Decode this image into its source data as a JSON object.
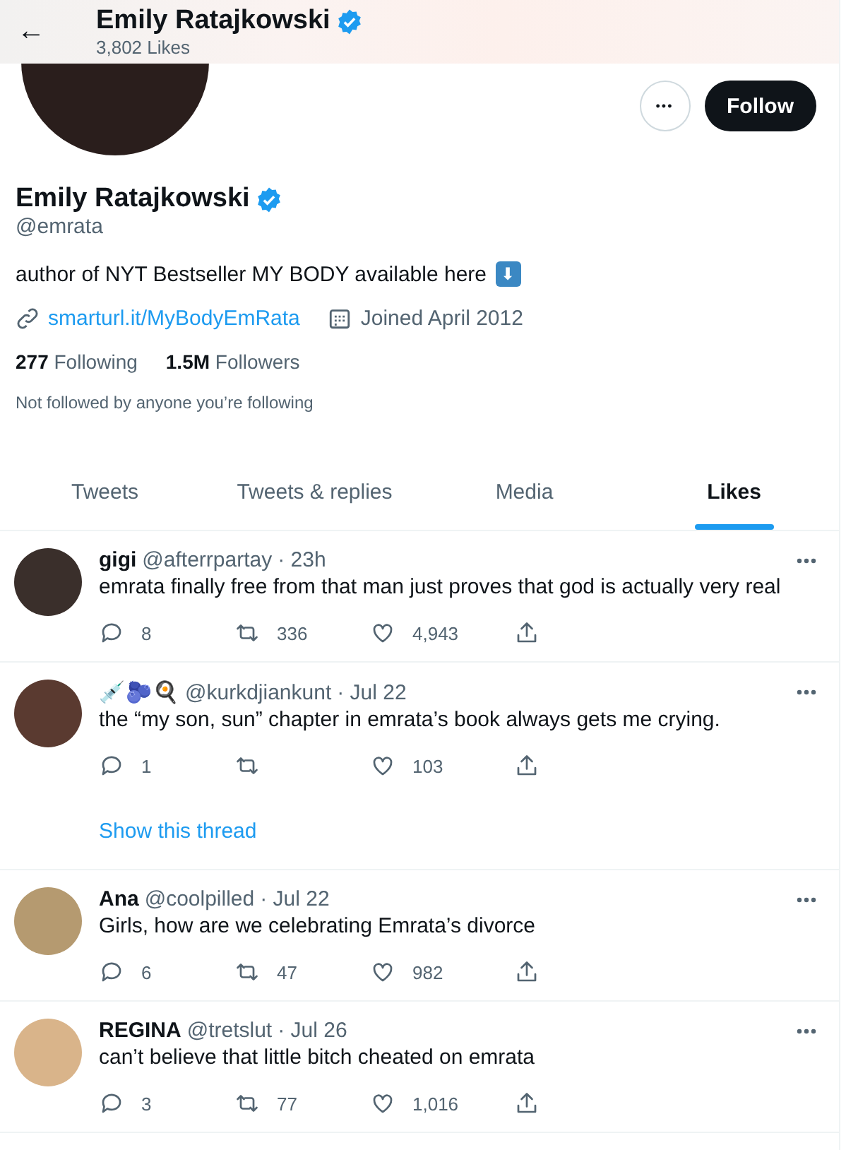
{
  "header": {
    "back": "←",
    "name": "Emily Ratajkowski",
    "verified": true,
    "subtitle": "3,802 Likes"
  },
  "profile": {
    "more": "•••",
    "follow": "Follow",
    "name": "Emily Ratajkowski",
    "verified": true,
    "handle": "@emrata",
    "bio": "author of NYT Bestseller MY BODY available here",
    "bio_emoji": "⬇",
    "link": "smarturl.it/MyBodyEmRata",
    "joined": "Joined April 2012",
    "following_count": "277",
    "following_label": "Following",
    "followers_count": "1.5M",
    "followers_label": "Followers",
    "note": "Not followed by anyone you’re following"
  },
  "tabs": [
    {
      "label": "Tweets",
      "selected": false
    },
    {
      "label": "Tweets & replies",
      "selected": false
    },
    {
      "label": "Media",
      "selected": false
    },
    {
      "label": "Likes",
      "selected": true
    }
  ],
  "tweets": [
    {
      "name": "gigi",
      "handle": "@afterrpartay",
      "time": "· 23h",
      "text": "emrata finally free from that man just proves that god is actually very real",
      "replies": "8",
      "retweets": "336",
      "likes": "4,943"
    },
    {
      "name": "💉🫐🍳",
      "handle": "@kurkdjiankunt",
      "time": "· Jul 22",
      "text": "the “my son, sun” chapter in emrata’s book always gets me crying.",
      "replies": "1",
      "likes": "103",
      "thread_link": "Show this thread"
    },
    {
      "name": "Ana",
      "handle": "@coolpilled",
      "time": "· Jul 22",
      "text": "Girls, how are we celebrating Emrata’s divorce",
      "replies": "6",
      "retweets": "47",
      "likes": "982"
    },
    {
      "name": "REGINA",
      "handle": "@tretslut",
      "time": "· Jul 26",
      "text": "can’t believe that little bitch cheated on emrata",
      "replies": "3",
      "retweets": "77",
      "likes": "1,016"
    }
  ]
}
